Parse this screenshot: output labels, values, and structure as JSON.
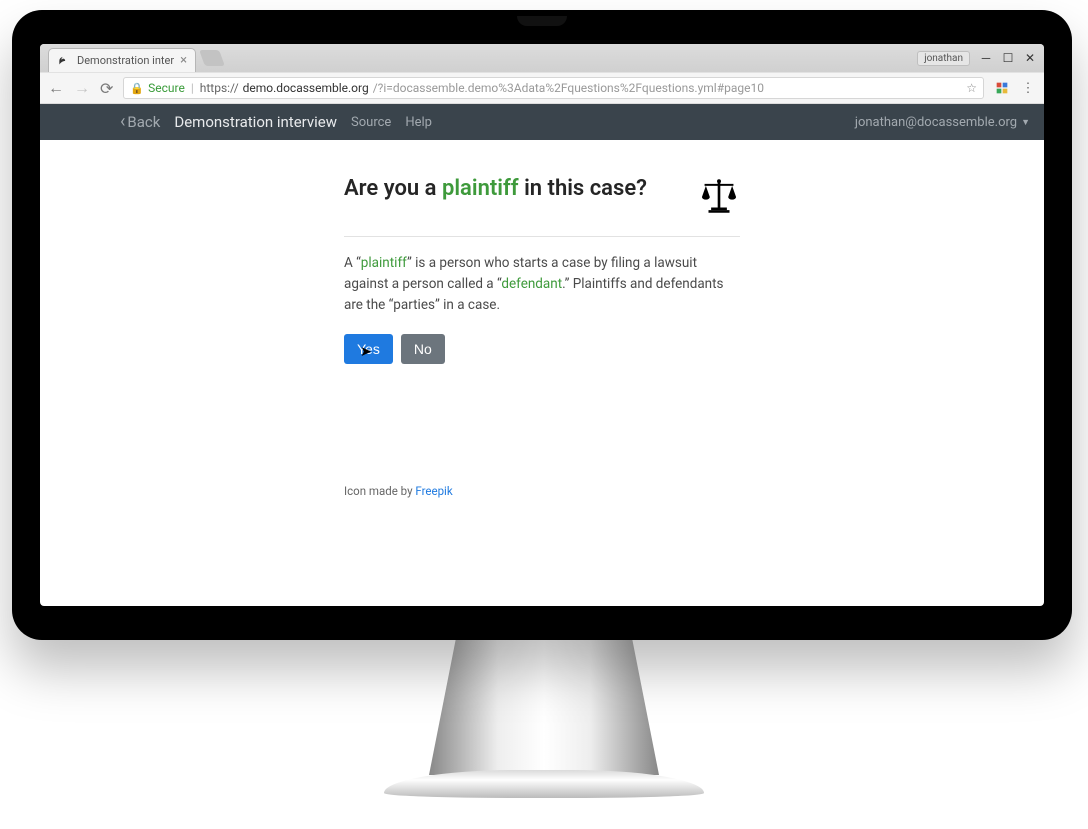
{
  "browser": {
    "tab_title": "Demonstration inter",
    "profile_name": "jonathan",
    "secure_label": "Secure",
    "url_scheme": "https://",
    "url_host": "demo.docassemble.org",
    "url_path": "/?i=docassemble.demo%3Adata%2Fquestions%2Fquestions.yml#page10"
  },
  "nav": {
    "back_label": "Back",
    "brand": "Demonstration interview",
    "links": [
      "Source",
      "Help"
    ],
    "user_email": "jonathan@docassemble.org"
  },
  "question": {
    "title_prefix": "Are you a ",
    "title_term": "plaintiff",
    "title_suffix": " in this case?",
    "desc_p1a": "A “",
    "desc_term1": "plaintiff",
    "desc_p1b": "” is a person who starts a case by filing a lawsuit against a person called a “",
    "desc_term2": "defendant",
    "desc_p1c": ".” Plaintiffs and defendants are the “parties” in a case.",
    "yes_label": "Yes",
    "no_label": "No"
  },
  "footer": {
    "prefix": "Icon made by ",
    "link_text": "Freepik"
  }
}
